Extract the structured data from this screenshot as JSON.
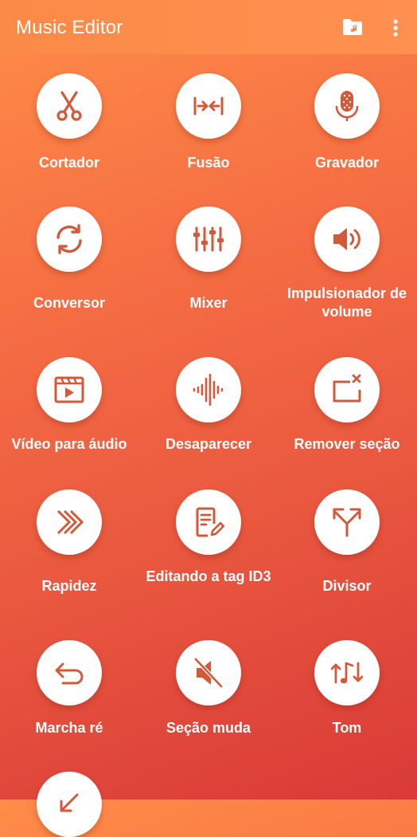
{
  "appbar": {
    "title": "Music Editor",
    "icons": [
      "music-folder-icon",
      "more-vert-icon"
    ],
    "color": "#fb8a47"
  },
  "theme": {
    "icon_color": "#d2593a",
    "circle_color": "#ffffff",
    "gradient_top": "#ff8c48",
    "gradient_bottom": "#d93a37"
  },
  "tools": [
    {
      "label": "Cortador",
      "icon": "scissors-icon"
    },
    {
      "label": "Fusão",
      "icon": "merge-icon"
    },
    {
      "label": "Gravador",
      "icon": "microphone-icon"
    },
    {
      "label": "Conversor",
      "icon": "convert-icon"
    },
    {
      "label": "Mixer",
      "icon": "mixer-sliders-icon"
    },
    {
      "label": "Impulsionador de volume",
      "icon": "volume-up-icon"
    },
    {
      "label": "Vídeo para áudio",
      "icon": "video-clapper-icon"
    },
    {
      "label": "Desaparecer",
      "icon": "waveform-icon"
    },
    {
      "label": "Remover seção",
      "icon": "remove-section-icon"
    },
    {
      "label": "Rapidez",
      "icon": "speed-arrows-icon"
    },
    {
      "label": "Editando a tag ID3",
      "icon": "edit-tag-icon"
    },
    {
      "label": "Divisor",
      "icon": "split-icon"
    },
    {
      "label": "Marcha ré",
      "icon": "reverse-icon"
    },
    {
      "label": "Seção muda",
      "icon": "mute-icon"
    },
    {
      "label": "Tom",
      "icon": "pitch-icon"
    },
    {
      "label": "",
      "icon": "arrow-down-left-icon"
    }
  ]
}
